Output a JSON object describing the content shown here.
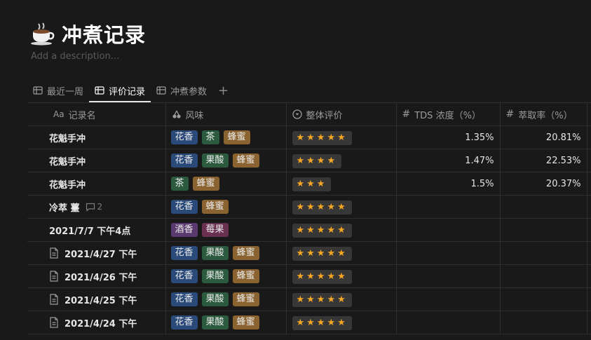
{
  "page": {
    "icon": "coffee-cup-icon",
    "title": "冲煮记录",
    "description_placeholder": "Add a description..."
  },
  "tabs": [
    {
      "label": "最近一周",
      "icon": "table-icon",
      "active": false
    },
    {
      "label": "评价记录",
      "icon": "table-icon",
      "active": true
    },
    {
      "label": "冲煮参数",
      "icon": "table-icon",
      "active": false
    }
  ],
  "columns": {
    "name": {
      "prefix": "Aa",
      "label": "记录名"
    },
    "flavor": {
      "label": "风味",
      "icon": "cherries-icon"
    },
    "rating": {
      "label": "整体评价",
      "icon": "select-icon"
    },
    "tds": {
      "label": "TDS 浓度（%）",
      "icon": "number-icon"
    },
    "extraction": {
      "label": "萃取率（%）",
      "icon": "number-icon"
    }
  },
  "tag_colors": {
    "花香": "#2a4a7a",
    "茶": "#2b5a3e",
    "蜂蜜": "#8a6331",
    "果酸": "#2b5a3e",
    "酒香": "#5a3a6e",
    "莓果": "#6a3050"
  },
  "rows": [
    {
      "name": "花魁手冲",
      "doc": false,
      "comments": "",
      "flavor": [
        "花香",
        "茶",
        "蜂蜜"
      ],
      "rating": "★★★★★",
      "tds": "1.35%",
      "extraction": "20.81%"
    },
    {
      "name": "花魁手冲",
      "doc": false,
      "comments": "",
      "flavor": [
        "花香",
        "果酸",
        "蜂蜜"
      ],
      "rating": "★★★★",
      "tds": "1.47%",
      "extraction": "22.53%"
    },
    {
      "name": "花魁手冲",
      "doc": false,
      "comments": "",
      "flavor": [
        "茶",
        "蜂蜜"
      ],
      "rating": "★★★",
      "tds": "1.5%",
      "extraction": "20.37%"
    },
    {
      "name": "冷萃 薹",
      "doc": false,
      "comments": "2",
      "flavor": [
        "花香",
        "蜂蜜"
      ],
      "rating": "★★★★★",
      "tds": "",
      "extraction": ""
    },
    {
      "name": "2021/7/7 下午4点",
      "doc": false,
      "comments": "",
      "flavor": [
        "酒香",
        "莓果"
      ],
      "rating": "★★★★★",
      "tds": "",
      "extraction": ""
    },
    {
      "name": "2021/4/27 下午",
      "doc": true,
      "comments": "",
      "flavor": [
        "花香",
        "果酸",
        "蜂蜜"
      ],
      "rating": "★★★★★",
      "tds": "",
      "extraction": ""
    },
    {
      "name": "2021/4/26 下午",
      "doc": true,
      "comments": "",
      "flavor": [
        "花香",
        "果酸",
        "蜂蜜"
      ],
      "rating": "★★★★★",
      "tds": "",
      "extraction": ""
    },
    {
      "name": "2021/4/25 下午",
      "doc": true,
      "comments": "",
      "flavor": [
        "花香",
        "果酸",
        "蜂蜜"
      ],
      "rating": "★★★★★",
      "tds": "",
      "extraction": ""
    },
    {
      "name": "2021/4/24 下午",
      "doc": true,
      "comments": "",
      "flavor": [
        "花香",
        "果酸",
        "蜂蜜"
      ],
      "rating": "★★★★★",
      "tds": "",
      "extraction": ""
    }
  ]
}
